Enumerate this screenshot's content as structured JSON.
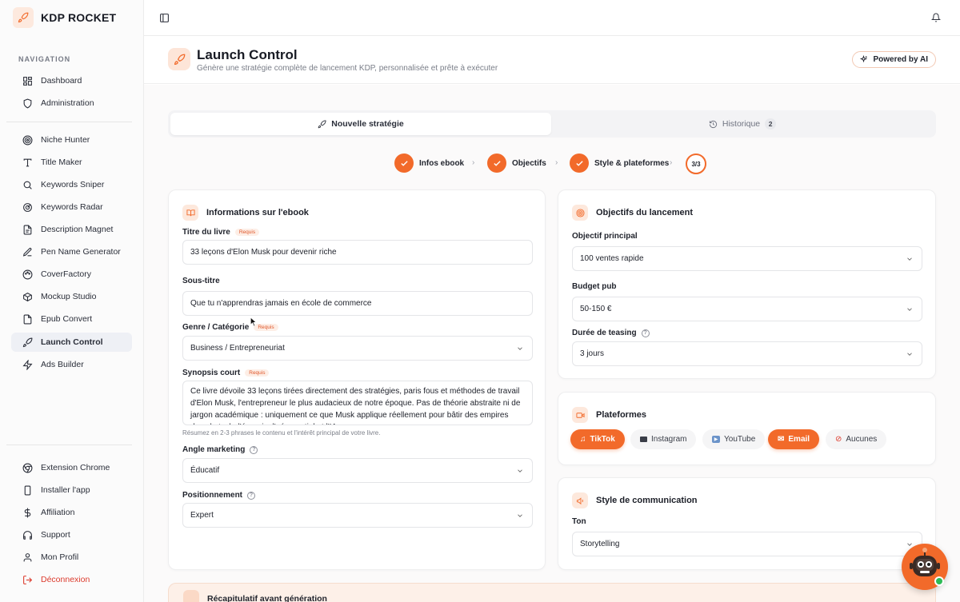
{
  "brand": {
    "name": "KDP ROCKET"
  },
  "sidebar": {
    "heading": "NAVIGATION",
    "items": [
      {
        "label": "Dashboard",
        "icon": "grid-icon"
      },
      {
        "label": "Administration",
        "icon": "shield-icon"
      },
      {
        "label": "Niche Hunter",
        "icon": "target-icon"
      },
      {
        "label": "Title Maker",
        "icon": "type-icon"
      },
      {
        "label": "Keywords Sniper",
        "icon": "search-icon"
      },
      {
        "label": "Keywords Radar",
        "icon": "radar-icon"
      },
      {
        "label": "Description Magnet",
        "icon": "file-icon"
      },
      {
        "label": "Pen Name Generator",
        "icon": "pen-icon"
      },
      {
        "label": "CoverFactory",
        "icon": "palette-icon"
      },
      {
        "label": "Mockup Studio",
        "icon": "box-icon"
      },
      {
        "label": "Epub Convert",
        "icon": "book-file-icon"
      },
      {
        "label": "Launch Control",
        "icon": "rocket-icon"
      },
      {
        "label": "Ads Builder",
        "icon": "zap-icon"
      }
    ],
    "bottom": [
      {
        "label": "Extension Chrome",
        "icon": "chrome-icon"
      },
      {
        "label": "Installer l'app",
        "icon": "phone-icon"
      },
      {
        "label": "Affiliation",
        "icon": "dollar-icon"
      },
      {
        "label": "Support",
        "icon": "headphones-icon"
      },
      {
        "label": "Mon Profil",
        "icon": "user-icon"
      },
      {
        "label": "Déconnexion",
        "icon": "logout-icon"
      }
    ]
  },
  "header": {
    "title": "Launch Control",
    "subtitle": "Génère une stratégie complète de lancement KDP, personnalisée et prête à exécuter",
    "powered": "Powered by AI"
  },
  "tabs": {
    "new": "Nouvelle stratégie",
    "history": "Historique",
    "history_count": "2"
  },
  "stepper": {
    "steps": [
      "Infos ebook",
      "Objectifs",
      "Style & plateformes"
    ],
    "final": "3/3"
  },
  "ebook": {
    "title": "Informations sur l'ebook",
    "required": "Requis",
    "book_title_label": "Titre du livre",
    "book_title_value": "33 leçons d'Elon Musk pour devenir riche",
    "subtitle_label": "Sous-titre",
    "subtitle_value": "Que tu n'apprendras jamais en école de commerce",
    "genre_label": "Genre / Catégorie",
    "genre_value": "Business / Entrepreneuriat",
    "synopsis_label": "Synopsis court",
    "synopsis_value": "Ce livre dévoile 33 leçons tirées directement des stratégies, paris fous et méthodes de travail d'Elon Musk, l'entrepreneur le plus audacieux de notre époque. Pas de théorie abstraite ni de jargon académique : uniquement ce que Musk applique réellement pour bâtir des empires dans la tech, l'énergie, l'aérospatial et l'IA.",
    "synopsis_hint": "Résumez en 2-3 phrases le contenu et l'intérêt principal de votre livre.",
    "angle_label": "Angle marketing",
    "angle_value": "Éducatif",
    "position_label": "Positionnement",
    "position_value": "Expert"
  },
  "objectives": {
    "title": "Objectifs du lancement",
    "main_label": "Objectif principal",
    "main_value": "100 ventes rapide",
    "budget_label": "Budget pub",
    "budget_value": "50-150 €",
    "teasing_label": "Durée de teasing",
    "teasing_value": "3 jours"
  },
  "platforms": {
    "title": "Plateformes",
    "chips": [
      {
        "label": "TikTok",
        "icon": "music-note-icon",
        "selected": true
      },
      {
        "label": "Instagram",
        "icon": "camera-icon",
        "selected": false
      },
      {
        "label": "YouTube",
        "icon": "play-icon",
        "selected": false
      },
      {
        "label": "Email",
        "icon": "mail-icon",
        "selected": true
      },
      {
        "label": "Aucunes",
        "icon": "no-entry-icon",
        "selected": false
      }
    ]
  },
  "style": {
    "title": "Style de communication",
    "tone_label": "Ton",
    "tone_value": "Storytelling"
  },
  "summary": {
    "title": "Récapitulatif avant génération"
  },
  "colors": {
    "accent": "#f26a2a",
    "accent_soft": "#fde8dc",
    "online": "#2dbb57",
    "danger": "#dc3a2c"
  }
}
